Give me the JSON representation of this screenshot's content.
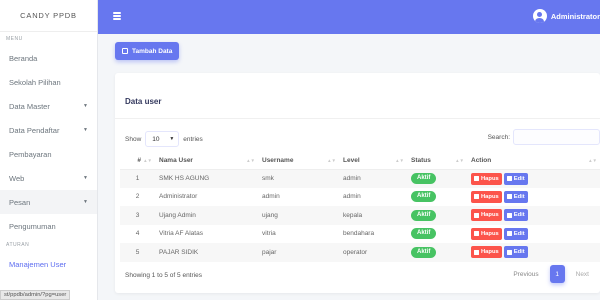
{
  "sidebar": {
    "brand": "CANDY PPDB",
    "section_menu": "MENU",
    "section_pengaturan": "ATURAN",
    "items": [
      {
        "label": "Beranda"
      },
      {
        "label": "Sekolah Pilihan"
      },
      {
        "label": "Data Master",
        "caret": "▼"
      },
      {
        "label": "Data Pendaftar",
        "caret": "▼"
      },
      {
        "label": "Pembayaran"
      },
      {
        "label": "Web",
        "caret": "▼"
      },
      {
        "label": "Pesan",
        "caret": "▼"
      },
      {
        "label": "Pengumuman"
      },
      {
        "label": "Manajemen User"
      }
    ]
  },
  "topbar": {
    "user_name": "Administrator"
  },
  "toolbar": {
    "add_label": "Tambah Data"
  },
  "card": {
    "title": "Data user",
    "show_label": "Show",
    "entries_value": "10",
    "entries_label": "entries",
    "search_label": "Search:"
  },
  "table": {
    "headers": [
      "#",
      "Nama User",
      "Username",
      "Level",
      "Status",
      "Action"
    ],
    "rows": [
      {
        "no": "1",
        "name": "SMK HS AGUNG",
        "username": "smk",
        "level": "admin",
        "status": "Aktif"
      },
      {
        "no": "2",
        "name": "Administrator",
        "username": "admin",
        "level": "admin",
        "status": "Aktif"
      },
      {
        "no": "3",
        "name": "Ujang Admin",
        "username": "ujang",
        "level": "kepala",
        "status": "Aktif"
      },
      {
        "no": "4",
        "name": "Vitria AF Alatas",
        "username": "vitria",
        "level": "bendahara",
        "status": "Aktif"
      },
      {
        "no": "5",
        "name": "PAJAR SIDIK",
        "username": "pajar",
        "level": "operator",
        "status": "Aktif"
      }
    ],
    "delete_label": "Hapus",
    "edit_label": "Edit"
  },
  "footer": {
    "info": "Showing 1 to 5 of 5 entries",
    "previous": "Previous",
    "current_page": "1",
    "next": "Next"
  },
  "status_url": "st/ppdb/admin/?pg=user",
  "colors": {
    "primary": "#6777ef",
    "success": "#47c363",
    "danger": "#fc544b"
  }
}
